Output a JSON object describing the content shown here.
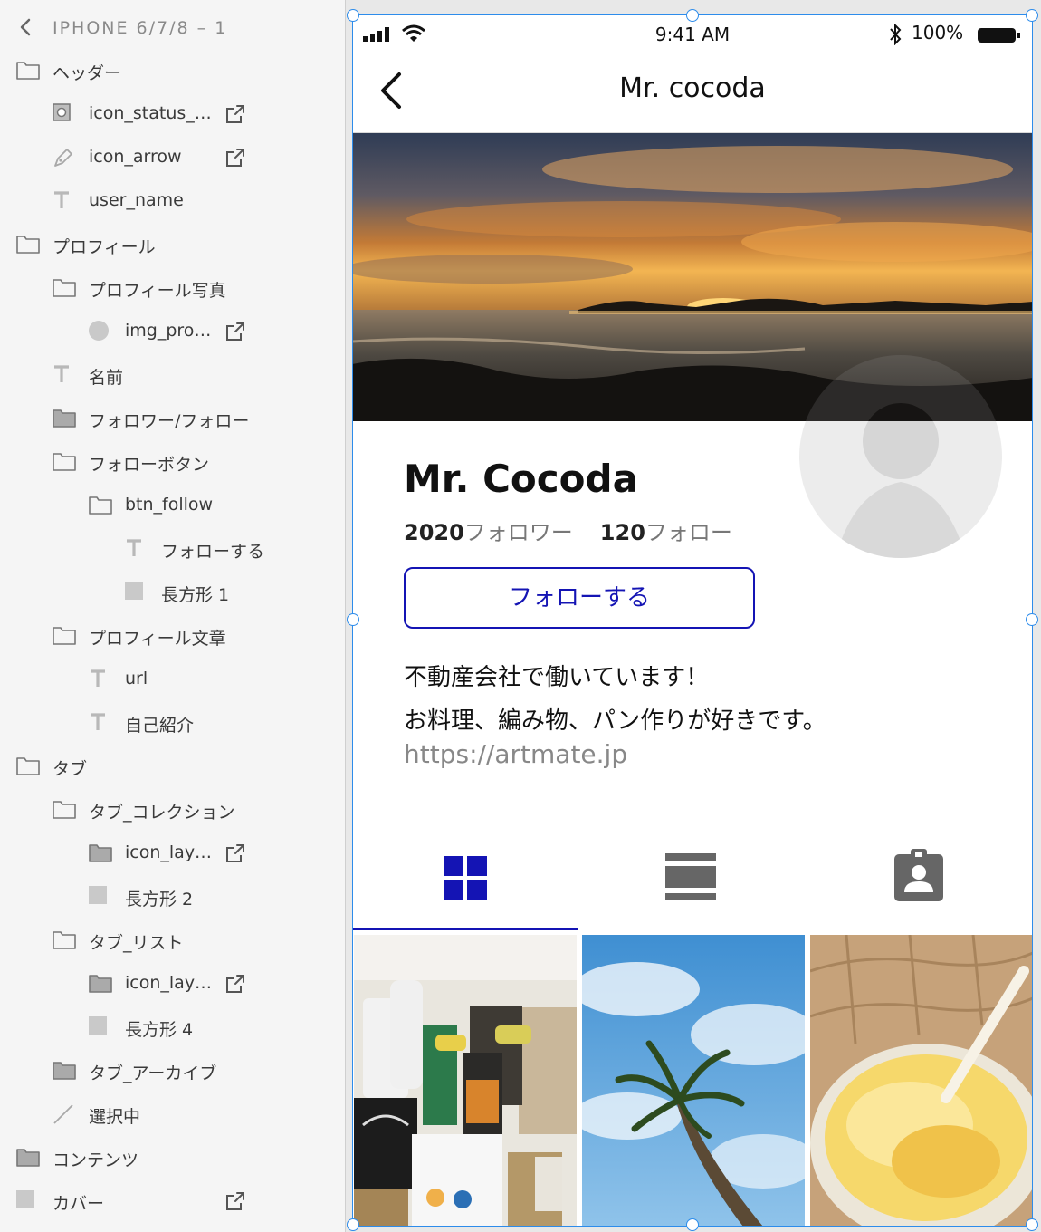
{
  "layers_panel": {
    "title": "IPHONE 6/7/8 – 1",
    "layers": [
      {
        "label": "ヘッダー",
        "type": "folder",
        "depth": 0,
        "link": false
      },
      {
        "label": "icon_status_…",
        "type": "component",
        "depth": 1,
        "link": true
      },
      {
        "label": "icon_arrow",
        "type": "pen",
        "depth": 1,
        "link": true
      },
      {
        "label": "user_name",
        "type": "text",
        "depth": 1,
        "link": false
      },
      {
        "label": "プロフィール",
        "type": "folder",
        "depth": 0,
        "link": false
      },
      {
        "label": "プロフィール写真",
        "type": "folder",
        "depth": 1,
        "link": false
      },
      {
        "label": "img_pro…",
        "type": "ellipse",
        "depth": 2,
        "link": true
      },
      {
        "label": "名前",
        "type": "text",
        "depth": 1,
        "link": false
      },
      {
        "label": "フォロワー/フォロー",
        "type": "folder-filled",
        "depth": 1,
        "link": false
      },
      {
        "label": "フォローボタン",
        "type": "folder",
        "depth": 1,
        "link": false
      },
      {
        "label": "btn_follow",
        "type": "folder",
        "depth": 2,
        "link": false
      },
      {
        "label": "フォローする",
        "type": "text",
        "depth": 3,
        "link": false
      },
      {
        "label": "長方形 1",
        "type": "rectangle",
        "depth": 3,
        "link": false
      },
      {
        "label": "プロフィール文章",
        "type": "folder",
        "depth": 1,
        "link": false
      },
      {
        "label": "url",
        "type": "text",
        "depth": 2,
        "link": false
      },
      {
        "label": "自己紹介",
        "type": "text",
        "depth": 2,
        "link": false
      },
      {
        "label": "タブ",
        "type": "folder",
        "depth": 0,
        "link": false
      },
      {
        "label": "タブ_コレクション",
        "type": "folder",
        "depth": 1,
        "link": false
      },
      {
        "label": "icon_lay…",
        "type": "folder-filled",
        "depth": 2,
        "link": true
      },
      {
        "label": "長方形 2",
        "type": "rectangle",
        "depth": 2,
        "link": false
      },
      {
        "label": "タブ_リスト",
        "type": "folder",
        "depth": 1,
        "link": false
      },
      {
        "label": "icon_lay…",
        "type": "folder-filled",
        "depth": 2,
        "link": true
      },
      {
        "label": "長方形 4",
        "type": "rectangle",
        "depth": 2,
        "link": false
      },
      {
        "label": "タブ_アーカイブ",
        "type": "folder-filled",
        "depth": 1,
        "link": false
      },
      {
        "label": "選択中",
        "type": "line",
        "depth": 1,
        "link": false
      },
      {
        "label": "コンテンツ",
        "type": "folder-filled",
        "depth": 0,
        "link": false
      },
      {
        "label": "カバー",
        "type": "rectangle",
        "depth": 0,
        "link": true
      }
    ]
  },
  "artboard": {
    "status_bar": {
      "time": "9:41 AM",
      "battery": "100%"
    },
    "nav": {
      "title": "Mr. cocoda"
    },
    "profile": {
      "name": "Mr. Cocoda",
      "followers_count": "2020",
      "followers_label": "フォロワー",
      "following_count": "120",
      "following_label": "フォロー",
      "follow_button": "フォローする",
      "bio_line1": "不動産会社で働いています！",
      "bio_line2": "お料理、編み物、パン作りが好きです。",
      "url": "https://artmate.jp"
    },
    "tabs": [
      {
        "icon": "grid-icon",
        "selected": true
      },
      {
        "icon": "list-icon",
        "selected": false
      },
      {
        "icon": "contact-badge-icon",
        "selected": false
      }
    ],
    "photos": [
      {
        "subject": "hawaiian-coffee-goods"
      },
      {
        "subject": "palm-tree-sky"
      },
      {
        "subject": "shaved-ice"
      }
    ]
  },
  "colors": {
    "accent": "#1414b4",
    "selection": "#2d8ceb",
    "panel_bg": "#f5f5f5",
    "muted_text": "#888888"
  }
}
